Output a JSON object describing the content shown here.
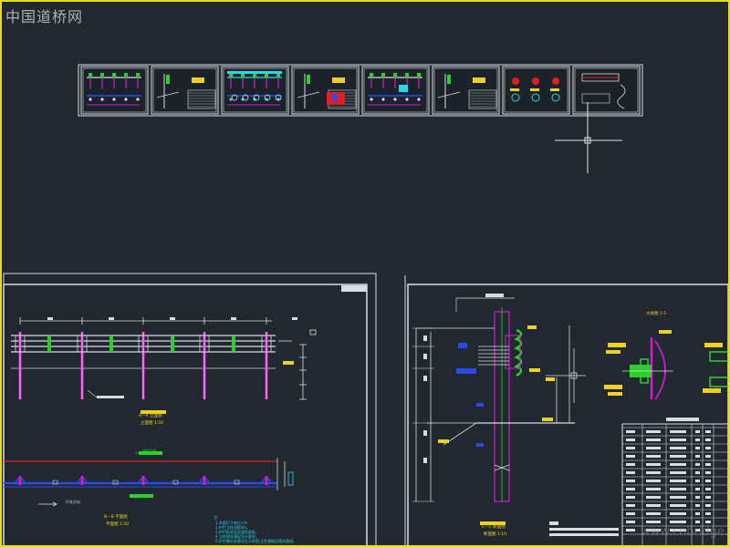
{
  "watermark": {
    "text": "中国道桥网"
  },
  "colors": {
    "background": "#212830",
    "frame": "#e8dc1a",
    "drawing_line": "#d6dce2",
    "magenta": "#d21ad2",
    "green": "#2ad12a",
    "yellow": "#f0d21e",
    "blue": "#2a4be8",
    "cyan": "#2ad7e8",
    "red": "#e02020"
  },
  "thumbnails": [
    {
      "id": 1,
      "kind": "guardrail-elevation"
    },
    {
      "id": 2,
      "kind": "section-table"
    },
    {
      "id": 3,
      "kind": "cyan-elevation"
    },
    {
      "id": 4,
      "kind": "section-detail"
    },
    {
      "id": 5,
      "kind": "barrier-elevation"
    },
    {
      "id": 6,
      "kind": "section-table"
    },
    {
      "id": 7,
      "kind": "details"
    },
    {
      "id": 8,
      "kind": "plan-detail"
    }
  ],
  "left_sheet": {
    "elevation_title": "A—A 立面图",
    "elevation_scale": "立面图 1:50",
    "plan_title": "B—B 平面图",
    "plan_scale": "平面图 1:50",
    "dim_labels": [
      "400",
      "400",
      "400",
      "400",
      "400",
      "400"
    ],
    "callout_green": "波形梁板",
    "callout_green_2": "立柱",
    "callout_white": "行车方向",
    "notes_title": "注:",
    "notes": [
      "1.本图尺寸单位:cm",
      "2.护栏立柱间距4m。",
      "3.护栏板采用双波形梁板。",
      "4.立柱埋深满足设计要求。",
      "5.护栏端头处理详见大样图,立柱基础见相关图纸。"
    ]
  },
  "right_sheet": {
    "section_title": "C—C 断面图",
    "section_scale": "断面图 1:10",
    "detail_title": "大样图 1:5",
    "table_headers": [
      "编号",
      "名称",
      "规格",
      "单位",
      "数量",
      "备注"
    ],
    "table_rows": 13
  },
  "url_watermark": "www.cnbridge.cn"
}
